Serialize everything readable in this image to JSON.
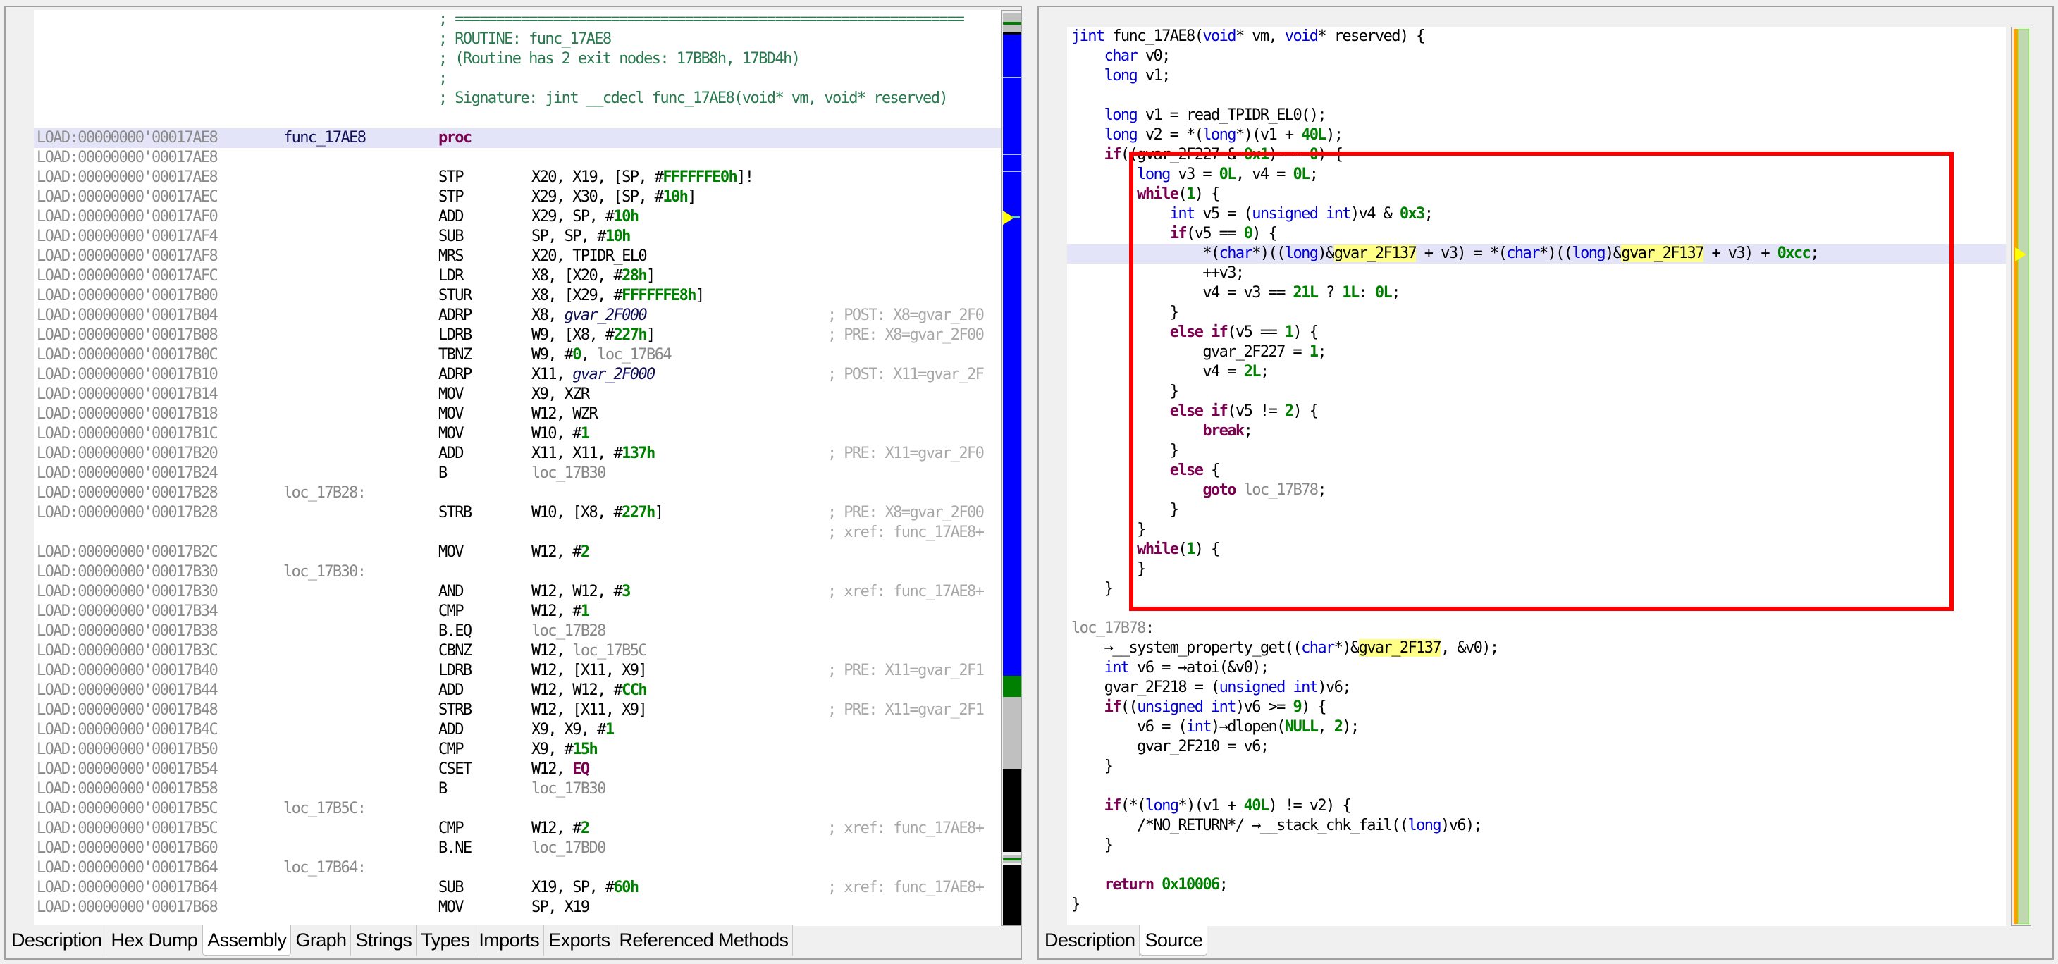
{
  "left_panel": {
    "header_comments": [
      "; ==============================================================",
      "; ROUTINE: func_17AE8",
      "; (Routine has 2 exit nodes: 17BB8h, 17BD4h)",
      ";",
      "; Signature: jint __cdecl func_17AE8(void* vm, void* reserved)"
    ],
    "rows": [
      {
        "addr": "LOAD:00000000'00017AE8",
        "label": "func_17AE8",
        "mnemonic": "proc",
        "ops": "",
        "comment": "",
        "selected": true
      },
      {
        "addr": "LOAD:00000000'00017AE8",
        "label": "",
        "mnemonic": "",
        "ops": "",
        "comment": ""
      },
      {
        "addr": "LOAD:00000000'00017AE8",
        "label": "",
        "mnemonic": "STP",
        "ops": "X20, X19, [SP, #FFFFFFE0h]!",
        "comment": ""
      },
      {
        "addr": "LOAD:00000000'00017AEC",
        "label": "",
        "mnemonic": "STP",
        "ops": "X29, X30, [SP, #10h]",
        "comment": ""
      },
      {
        "addr": "LOAD:00000000'00017AF0",
        "label": "",
        "mnemonic": "ADD",
        "ops": "X29, SP, #10h",
        "comment": ""
      },
      {
        "addr": "LOAD:00000000'00017AF4",
        "label": "",
        "mnemonic": "SUB",
        "ops": "SP, SP, #10h",
        "comment": ""
      },
      {
        "addr": "LOAD:00000000'00017AF8",
        "label": "",
        "mnemonic": "MRS",
        "ops": "X20, TPIDR_EL0",
        "comment": ""
      },
      {
        "addr": "LOAD:00000000'00017AFC",
        "label": "",
        "mnemonic": "LDR",
        "ops": "X8, [X20, #28h]",
        "comment": ""
      },
      {
        "addr": "LOAD:00000000'00017B00",
        "label": "",
        "mnemonic": "STUR",
        "ops": "X8, [X29, #FFFFFFE8h]",
        "comment": ""
      },
      {
        "addr": "LOAD:00000000'00017B04",
        "label": "",
        "mnemonic": "ADRP",
        "ops": "X8, gvar_2F000",
        "comment": "; POST: X8=gvar_2F0"
      },
      {
        "addr": "LOAD:00000000'00017B08",
        "label": "",
        "mnemonic": "LDRB",
        "ops": "W9, [X8, #227h]",
        "comment": "; PRE: X8=gvar_2F00"
      },
      {
        "addr": "LOAD:00000000'00017B0C",
        "label": "",
        "mnemonic": "TBNZ",
        "ops": "W9, #0, loc_17B64",
        "comment": ""
      },
      {
        "addr": "LOAD:00000000'00017B10",
        "label": "",
        "mnemonic": "ADRP",
        "ops": "X11, gvar_2F000",
        "comment": "; POST: X11=gvar_2F"
      },
      {
        "addr": "LOAD:00000000'00017B14",
        "label": "",
        "mnemonic": "MOV",
        "ops": "X9, XZR",
        "comment": ""
      },
      {
        "addr": "LOAD:00000000'00017B18",
        "label": "",
        "mnemonic": "MOV",
        "ops": "W12, WZR",
        "comment": ""
      },
      {
        "addr": "LOAD:00000000'00017B1C",
        "label": "",
        "mnemonic": "MOV",
        "ops": "W10, #1",
        "comment": ""
      },
      {
        "addr": "LOAD:00000000'00017B20",
        "label": "",
        "mnemonic": "ADD",
        "ops": "X11, X11, #137h",
        "comment": "; PRE: X11=gvar_2F0"
      },
      {
        "addr": "LOAD:00000000'00017B24",
        "label": "",
        "mnemonic": "B",
        "ops": "loc_17B30",
        "comment": ""
      },
      {
        "addr": "LOAD:00000000'00017B28",
        "label": "loc_17B28:",
        "mnemonic": "",
        "ops": "",
        "comment": ""
      },
      {
        "addr": "LOAD:00000000'00017B28",
        "label": "",
        "mnemonic": "STRB",
        "ops": "W10, [X8, #227h]",
        "comment": "; PRE: X8=gvar_2F00"
      },
      {
        "addr": "",
        "label": "",
        "mnemonic": "",
        "ops": "",
        "comment": "; xref: func_17AE8+"
      },
      {
        "addr": "LOAD:00000000'00017B2C",
        "label": "",
        "mnemonic": "MOV",
        "ops": "W12, #2",
        "comment": ""
      },
      {
        "addr": "LOAD:00000000'00017B30",
        "label": "loc_17B30:",
        "mnemonic": "",
        "ops": "",
        "comment": ""
      },
      {
        "addr": "LOAD:00000000'00017B30",
        "label": "",
        "mnemonic": "AND",
        "ops": "W12, W12, #3",
        "comment": "; xref: func_17AE8+"
      },
      {
        "addr": "LOAD:00000000'00017B34",
        "label": "",
        "mnemonic": "CMP",
        "ops": "W12, #1",
        "comment": ""
      },
      {
        "addr": "LOAD:00000000'00017B38",
        "label": "",
        "mnemonic": "B.EQ",
        "ops": "loc_17B28",
        "comment": ""
      },
      {
        "addr": "LOAD:00000000'00017B3C",
        "label": "",
        "mnemonic": "CBNZ",
        "ops": "W12, loc_17B5C",
        "comment": ""
      },
      {
        "addr": "LOAD:00000000'00017B40",
        "label": "",
        "mnemonic": "LDRB",
        "ops": "W12, [X11, X9]",
        "comment": "; PRE: X11=gvar_2F1"
      },
      {
        "addr": "LOAD:00000000'00017B44",
        "label": "",
        "mnemonic": "ADD",
        "ops": "W12, W12, #CCh",
        "comment": ""
      },
      {
        "addr": "LOAD:00000000'00017B48",
        "label": "",
        "mnemonic": "STRB",
        "ops": "W12, [X11, X9]",
        "comment": "; PRE: X11=gvar_2F1"
      },
      {
        "addr": "LOAD:00000000'00017B4C",
        "label": "",
        "mnemonic": "ADD",
        "ops": "X9, X9, #1",
        "comment": ""
      },
      {
        "addr": "LOAD:00000000'00017B50",
        "label": "",
        "mnemonic": "CMP",
        "ops": "X9, #15h",
        "comment": ""
      },
      {
        "addr": "LOAD:00000000'00017B54",
        "label": "",
        "mnemonic": "CSET",
        "ops": "W12, EQ",
        "comment": ""
      },
      {
        "addr": "LOAD:00000000'00017B58",
        "label": "",
        "mnemonic": "B",
        "ops": "loc_17B30",
        "comment": ""
      },
      {
        "addr": "LOAD:00000000'00017B5C",
        "label": "loc_17B5C:",
        "mnemonic": "",
        "ops": "",
        "comment": ""
      },
      {
        "addr": "LOAD:00000000'00017B5C",
        "label": "",
        "mnemonic": "CMP",
        "ops": "W12, #2",
        "comment": "; xref: func_17AE8+"
      },
      {
        "addr": "LOAD:00000000'00017B60",
        "label": "",
        "mnemonic": "B.NE",
        "ops": "loc_17BD0",
        "comment": ""
      },
      {
        "addr": "LOAD:00000000'00017B64",
        "label": "loc_17B64:",
        "mnemonic": "",
        "ops": "",
        "comment": ""
      },
      {
        "addr": "LOAD:00000000'00017B64",
        "label": "",
        "mnemonic": "SUB",
        "ops": "X19, SP, #60h",
        "comment": "; xref: func_17AE8+"
      },
      {
        "addr": "LOAD:00000000'00017B68",
        "label": "",
        "mnemonic": "MOV",
        "ops": "SP, X19",
        "comment": ""
      }
    ],
    "tabs": [
      "Description",
      "Hex Dump",
      "Assembly",
      "Graph",
      "Strings",
      "Types",
      "Imports",
      "Exports",
      "Referenced Methods"
    ],
    "active_tab": "Assembly"
  },
  "right_panel": {
    "source_lines": [
      "jint func_17AE8(void* vm, void* reserved) {",
      "    char v0;",
      "    long v1;",
      "",
      "    long v1 = read_TPIDR_EL0();",
      "    long v2 = *(long*)(v1 + 40L);",
      "    if((gvar_2F227 & 0x1) == 0) {",
      "        long v3 = 0L, v4 = 0L;",
      "        while(1) {",
      "            int v5 = (unsigned int)v4 & 0x3;",
      "            if(v5 == 0) {",
      "                *(char*)((long)&gvar_2F137 + v3) = *(char*)((long)&gvar_2F137 + v3) + 0xcc;",
      "                ++v3;",
      "                v4 = v3 == 21L ? 1L: 0L;",
      "            }",
      "            else if(v5 == 1) {",
      "                gvar_2F227 = 1;",
      "                v4 = 2L;",
      "            }",
      "            else if(v5 != 2) {",
      "                break;",
      "            }",
      "            else {",
      "                goto loc_17B78;",
      "            }",
      "        }",
      "        while(1) {",
      "        }",
      "    }",
      "",
      "loc_17B78:",
      "    →__system_property_get((char*)&gvar_2F137, &v0);",
      "    int v6 = →atoi(&v0);",
      "    gvar_2F218 = (unsigned int)v6;",
      "    if((unsigned int)v6 >= 9) {",
      "        v6 = (int)→dlopen(NULL, 2);",
      "        gvar_2F210 = v6;",
      "    }",
      "",
      "    if(*(long*)(v1 + 40L) != v2) {",
      "        /*NO_RETURN*/ →__stack_chk_fail((long)v6);",
      "    }",
      "",
      "    return 0x10006;",
      "}"
    ],
    "highlighted_line_index": 11,
    "highlighted_symbol": "gvar_2F137",
    "annotation_box": {
      "color": "#ff0000",
      "from_line": 6,
      "to_line": 29
    },
    "tabs": [
      "Description",
      "Source"
    ],
    "active_tab": "Source"
  },
  "colors": {
    "keyword": "#7a0050",
    "type": "#0000d8",
    "number": "#008000",
    "address": "#8a8a8a",
    "comment": "#a8a8a8",
    "selection": "#e4e4f8",
    "symbol_highlight": "#ffff88",
    "overview_code": "#0000ff"
  }
}
